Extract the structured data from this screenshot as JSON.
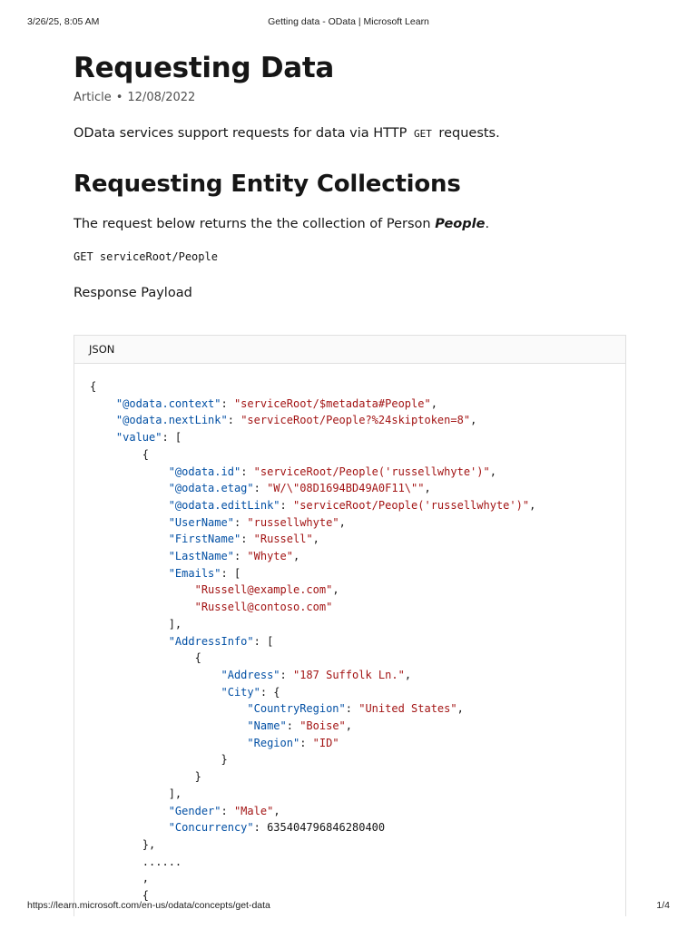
{
  "print_header": {
    "date": "3/26/25, 8:05 AM",
    "title": "Getting data - OData | Microsoft Learn"
  },
  "print_footer": {
    "url": "https://learn.microsoft.com/en-us/odata/concepts/get-data",
    "page": "1/4"
  },
  "article": {
    "title": "Requesting Data",
    "meta_type": "Article",
    "meta_separator": "•",
    "meta_date": "12/08/2022",
    "intro_before": "OData services support requests for data via HTTP ",
    "intro_code": "GET",
    "intro_after": " requests.",
    "section_title": "Requesting Entity Collections",
    "desc_before": "The request below returns the the collection of Person ",
    "desc_emphasis": "People",
    "desc_after": ".",
    "request_line": "GET serviceRoot/People",
    "payload_label": "Response Payload"
  },
  "code_block": {
    "language": "JSON",
    "colors": {
      "key": "#0451a5",
      "string": "#a31515",
      "plain": "#161616"
    },
    "lines": [
      [
        [
          "p",
          "{"
        ]
      ],
      [
        [
          "p",
          "    "
        ],
        [
          "k",
          "\"@odata.context\""
        ],
        [
          "p",
          ": "
        ],
        [
          "s",
          "\"serviceRoot/$metadata#People\""
        ],
        [
          "p",
          ","
        ]
      ],
      [
        [
          "p",
          "    "
        ],
        [
          "k",
          "\"@odata.nextLink\""
        ],
        [
          "p",
          ": "
        ],
        [
          "s",
          "\"serviceRoot/People?%24skiptoken=8\""
        ],
        [
          "p",
          ","
        ]
      ],
      [
        [
          "p",
          "    "
        ],
        [
          "k",
          "\"value\""
        ],
        [
          "p",
          ": ["
        ]
      ],
      [
        [
          "p",
          "        {"
        ]
      ],
      [
        [
          "p",
          "            "
        ],
        [
          "k",
          "\"@odata.id\""
        ],
        [
          "p",
          ": "
        ],
        [
          "s",
          "\"serviceRoot/People('russellwhyte')\""
        ],
        [
          "p",
          ","
        ]
      ],
      [
        [
          "p",
          "            "
        ],
        [
          "k",
          "\"@odata.etag\""
        ],
        [
          "p",
          ": "
        ],
        [
          "s",
          "\"W/\\\"08D1694BD49A0F11\\\"\""
        ],
        [
          "p",
          ","
        ]
      ],
      [
        [
          "p",
          "            "
        ],
        [
          "k",
          "\"@odata.editLink\""
        ],
        [
          "p",
          ": "
        ],
        [
          "s",
          "\"serviceRoot/People('russellwhyte')\""
        ],
        [
          "p",
          ","
        ]
      ],
      [
        [
          "p",
          "            "
        ],
        [
          "k",
          "\"UserName\""
        ],
        [
          "p",
          ": "
        ],
        [
          "s",
          "\"russellwhyte\""
        ],
        [
          "p",
          ","
        ]
      ],
      [
        [
          "p",
          "            "
        ],
        [
          "k",
          "\"FirstName\""
        ],
        [
          "p",
          ": "
        ],
        [
          "s",
          "\"Russell\""
        ],
        [
          "p",
          ","
        ]
      ],
      [
        [
          "p",
          "            "
        ],
        [
          "k",
          "\"LastName\""
        ],
        [
          "p",
          ": "
        ],
        [
          "s",
          "\"Whyte\""
        ],
        [
          "p",
          ","
        ]
      ],
      [
        [
          "p",
          "            "
        ],
        [
          "k",
          "\"Emails\""
        ],
        [
          "p",
          ": ["
        ]
      ],
      [
        [
          "p",
          "                "
        ],
        [
          "s",
          "\"Russell@example.com\""
        ],
        [
          "p",
          ","
        ]
      ],
      [
        [
          "p",
          "                "
        ],
        [
          "s",
          "\"Russell@contoso.com\""
        ]
      ],
      [
        [
          "p",
          "            ],"
        ]
      ],
      [
        [
          "p",
          "            "
        ],
        [
          "k",
          "\"AddressInfo\""
        ],
        [
          "p",
          ": ["
        ]
      ],
      [
        [
          "p",
          "                {"
        ]
      ],
      [
        [
          "p",
          "                    "
        ],
        [
          "k",
          "\"Address\""
        ],
        [
          "p",
          ": "
        ],
        [
          "s",
          "\"187 Suffolk Ln.\""
        ],
        [
          "p",
          ","
        ]
      ],
      [
        [
          "p",
          "                    "
        ],
        [
          "k",
          "\"City\""
        ],
        [
          "p",
          ": {"
        ]
      ],
      [
        [
          "p",
          "                        "
        ],
        [
          "k",
          "\"CountryRegion\""
        ],
        [
          "p",
          ": "
        ],
        [
          "s",
          "\"United States\""
        ],
        [
          "p",
          ","
        ]
      ],
      [
        [
          "p",
          "                        "
        ],
        [
          "k",
          "\"Name\""
        ],
        [
          "p",
          ": "
        ],
        [
          "s",
          "\"Boise\""
        ],
        [
          "p",
          ","
        ]
      ],
      [
        [
          "p",
          "                        "
        ],
        [
          "k",
          "\"Region\""
        ],
        [
          "p",
          ": "
        ],
        [
          "s",
          "\"ID\""
        ]
      ],
      [
        [
          "p",
          "                    }"
        ]
      ],
      [
        [
          "p",
          "                }"
        ]
      ],
      [
        [
          "p",
          "            ],"
        ]
      ],
      [
        [
          "p",
          "            "
        ],
        [
          "k",
          "\"Gender\""
        ],
        [
          "p",
          ": "
        ],
        [
          "s",
          "\"Male\""
        ],
        [
          "p",
          ","
        ]
      ],
      [
        [
          "p",
          "            "
        ],
        [
          "k",
          "\"Concurrency\""
        ],
        [
          "p",
          ": 635404796846280400"
        ]
      ],
      [
        [
          "p",
          "        },"
        ]
      ],
      [
        [
          "p",
          "        ......"
        ]
      ],
      [
        [
          "p",
          "        ,"
        ]
      ],
      [
        [
          "p",
          "        {"
        ]
      ]
    ]
  }
}
